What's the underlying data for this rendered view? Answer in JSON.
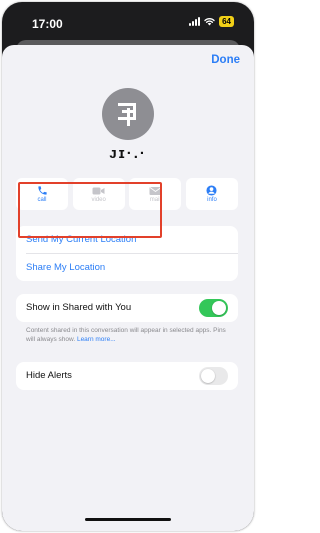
{
  "status_bar": {
    "time": "17:00",
    "battery": "64"
  },
  "header": {
    "done_label": "Done"
  },
  "contact": {
    "name": "ᴊɪ·.·"
  },
  "actions": [
    {
      "label": "call",
      "icon": "phone-icon",
      "enabled": true
    },
    {
      "label": "video",
      "icon": "video-icon",
      "enabled": false
    },
    {
      "label": "mail",
      "icon": "mail-icon",
      "enabled": false
    },
    {
      "label": "info",
      "icon": "person-icon",
      "enabled": true
    }
  ],
  "location": {
    "send_current": "Send My Current Location",
    "share": "Share My Location"
  },
  "shared_with_you": {
    "label": "Show in Shared with You",
    "enabled": true,
    "caption": "Content shared in this conversation will appear in selected apps. Pins will always show.",
    "learn_more": "Learn more..."
  },
  "hide_alerts": {
    "label": "Hide Alerts",
    "enabled": false
  },
  "colors": {
    "accent": "#2c7ef6",
    "toggle_on": "#34c759",
    "toggle_off": "#e9e9ea",
    "highlight": "#e2402a",
    "battery": "#f2d017"
  }
}
